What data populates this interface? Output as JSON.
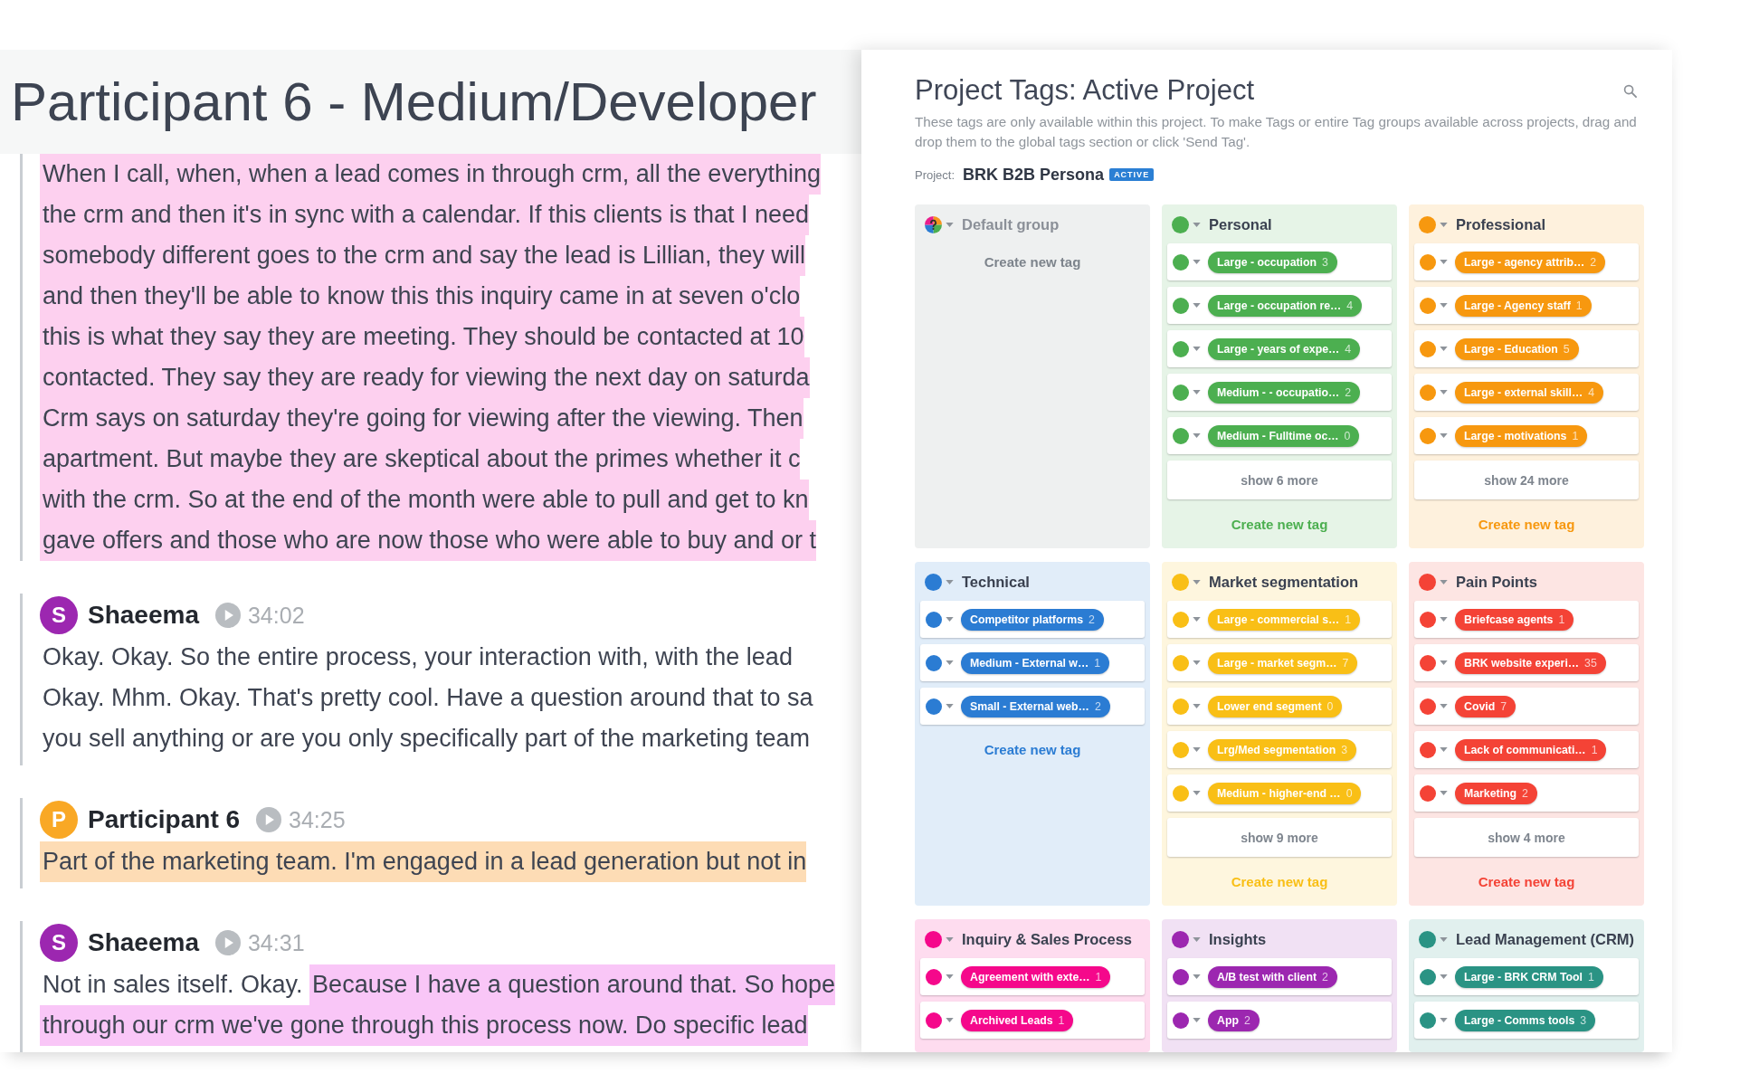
{
  "transcript": {
    "title": "Participant 6 - Medium/Developer",
    "blocks": [
      {
        "lines": [
          [
            {
              "text": "When I call, when, when a lead comes in through crm, all the everything",
              "color": "#fdd0ef"
            }
          ],
          [
            {
              "text": "the crm and then it's in sync with a calendar. If this clients is that I need",
              "color": "#fdd0ef"
            }
          ],
          [
            {
              "text": "somebody different goes to the crm and say the lead is Lillian, they will",
              "color": "#fdd0ef"
            }
          ],
          [
            {
              "text": "and then they'll be able to know this this inquiry came in at seven o'clo",
              "color": "#fdd0ef"
            }
          ],
          [
            {
              "text": "this is what they say they are meeting. They should be contacted at 10",
              "color": "#fdd0ef"
            }
          ],
          [
            {
              "text": "contacted. They say they are ready for viewing the next day on saturda",
              "color": "#fdd0ef"
            }
          ],
          [
            {
              "text": "Crm says on saturday they're going for viewing after the viewing. Then",
              "color": "#fdd0ef"
            }
          ],
          [
            {
              "text": "apartment. But maybe they are skeptical about the primes whether it c",
              "color": "#fdd0ef"
            }
          ],
          [
            {
              "text": "with the crm. So at the end of the month were able to pull and get to kn",
              "color": "#fdd0ef"
            }
          ],
          [
            {
              "text": "gave offers and those who are now those who were able to buy and or t",
              "color": "#fdd0ef"
            }
          ]
        ]
      },
      {
        "speaker": {
          "initial": "S",
          "name": "Shaeema",
          "color": "#9c27b0"
        },
        "time": "34:02",
        "lines": [
          [
            {
              "text": "Okay. Okay. So the entire process, your interaction with, with the lead"
            }
          ],
          [
            {
              "text": "Okay. Mhm. Okay. That's pretty cool. Have a question around that to sa"
            }
          ],
          [
            {
              "text": "you sell anything or are you only specifically part of the marketing team"
            }
          ]
        ]
      },
      {
        "speaker": {
          "initial": "P",
          "name": "Participant 6",
          "color": "#f9a825"
        },
        "time": "34:25",
        "lines": [
          [
            {
              "text": "Part of the marketing team. I'm engaged in a lead generation but not in",
              "color": "#fddcb5"
            }
          ]
        ]
      },
      {
        "speaker": {
          "initial": "S",
          "name": "Shaeema",
          "color": "#9c27b0"
        },
        "time": "34:31",
        "lines": [
          [
            {
              "text": "Not in sales itself. Okay. "
            },
            {
              "text": "Because I have a question around that. So hope",
              "color": "#f9c6f7"
            }
          ],
          [
            {
              "text": "through our crm we've gone through this process now. Do specific lead",
              "color": "#f9c6f7"
            }
          ]
        ]
      }
    ]
  },
  "tags_panel": {
    "title": "Project Tags: Active Project",
    "description": "These tags are only available within this project. To make Tags or entire Tag groups available across projects, drag and drop them to the global tags section or click 'Send Tag'.",
    "project_label": "Project:",
    "project_name": "BRK B2B Persona",
    "status_badge": "ACTIVE",
    "groups": [
      {
        "kind": "default",
        "name": "Default group",
        "create_label": "Create new tag"
      },
      {
        "kind": "colored",
        "name": "Personal",
        "color": "#4caf50",
        "tags": [
          {
            "name": "Large - occupation",
            "count": "3"
          },
          {
            "name": "Large - occupation re…",
            "count": "4"
          },
          {
            "name": "Large - years of expe…",
            "count": "4"
          },
          {
            "name": "Medium - - occupatio…",
            "count": "2"
          },
          {
            "name": "Medium - Fulltime oc…",
            "count": "0"
          }
        ],
        "show_more": "show 6 more",
        "create_label": "Create new tag"
      },
      {
        "kind": "colored",
        "name": "Professional",
        "color": "#f7980f",
        "tags": [
          {
            "name": "Large - agency attrib…",
            "count": "2"
          },
          {
            "name": "Large - Agency staff",
            "count": "1"
          },
          {
            "name": "Large - Education",
            "count": "5"
          },
          {
            "name": "Large - external skill…",
            "count": "4"
          },
          {
            "name": "Large - motivations",
            "count": "1"
          }
        ],
        "show_more": "show 24 more",
        "create_label": "Create new tag"
      },
      {
        "kind": "colored",
        "name": "Technical",
        "color": "#2b7cd3",
        "tags": [
          {
            "name": "Competitor platforms",
            "count": "2"
          },
          {
            "name": "Medium - External w…",
            "count": "1"
          },
          {
            "name": "Small - External web…",
            "count": "2"
          }
        ],
        "create_label": "Create new tag"
      },
      {
        "kind": "colored",
        "name": "Market segmentation",
        "color": "#f9bf16",
        "tags": [
          {
            "name": "Large - commercial s…",
            "count": "1"
          },
          {
            "name": "Large - market segm…",
            "count": "7"
          },
          {
            "name": "Lower end segment",
            "count": "0"
          },
          {
            "name": "Lrg/Med segmentation",
            "count": "3"
          },
          {
            "name": "Medium - higher-end …",
            "count": "0"
          }
        ],
        "show_more": "show 9 more",
        "create_label": "Create new tag"
      },
      {
        "kind": "colored",
        "name": "Pain Points",
        "color": "#f44336",
        "tags": [
          {
            "name": "Briefcase agents",
            "count": "1"
          },
          {
            "name": "BRK website experi…",
            "count": "35"
          },
          {
            "name": "Covid",
            "count": "7"
          },
          {
            "name": "Lack of communicati…",
            "count": "1"
          },
          {
            "name": "Marketing",
            "count": "2"
          }
        ],
        "show_more": "show 4 more",
        "create_label": "Create new tag"
      },
      {
        "kind": "colored",
        "name": "Inquiry & Sales Process",
        "color": "#f5088b",
        "tags": [
          {
            "name": "Agreement with exte…",
            "count": "1"
          },
          {
            "name": "Archived Leads",
            "count": "1"
          }
        ]
      },
      {
        "kind": "colored",
        "name": "Insights",
        "color": "#9c27b0",
        "tags": [
          {
            "name": "A/B test with client",
            "count": "2"
          },
          {
            "name": "App",
            "count": "2"
          }
        ]
      },
      {
        "kind": "colored",
        "name": "Lead Management (CRM)",
        "color": "#2a9384",
        "tags": [
          {
            "name": "Large - BRK CRM Tool",
            "count": "1"
          },
          {
            "name": "Large - Comms tools",
            "count": "3"
          }
        ]
      }
    ]
  }
}
